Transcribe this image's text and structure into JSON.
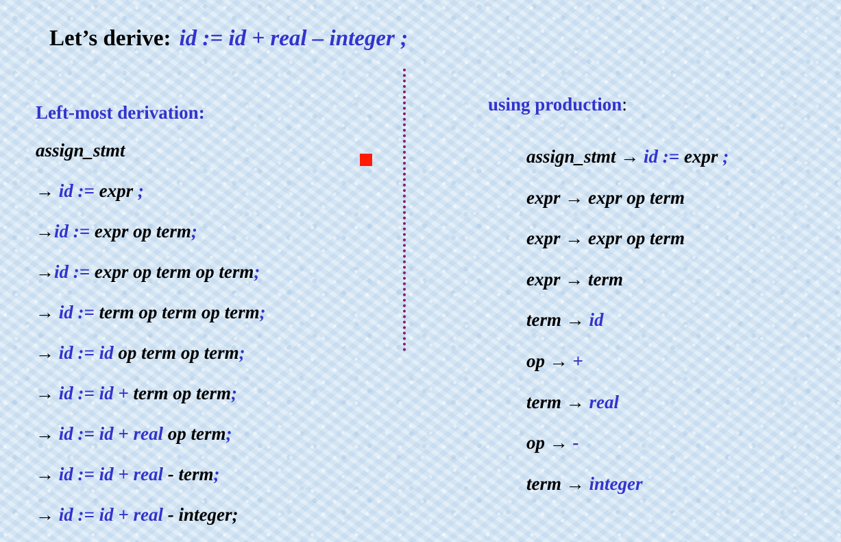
{
  "title": {
    "label": "Let’s derive:",
    "expression": "id := id + real – integer ;"
  },
  "left": {
    "heading": "Left-most derivation:",
    "rows": [
      [
        {
          "t": "assign_stmt",
          "c": "black"
        }
      ],
      [
        {
          "t": "→ ",
          "c": "black"
        },
        {
          "t": "id := ",
          "c": "blue"
        },
        {
          "t": "expr ",
          "c": "black"
        },
        {
          "t": ";",
          "c": "blue"
        }
      ],
      [
        {
          "t": "→",
          "c": "black"
        },
        {
          "t": "id := ",
          "c": "blue"
        },
        {
          "t": "expr op term",
          "c": "black"
        },
        {
          "t": ";",
          "c": "blue"
        }
      ],
      [
        {
          "t": "→",
          "c": "black"
        },
        {
          "t": "id := ",
          "c": "blue"
        },
        {
          "t": "expr op term op term",
          "c": "black"
        },
        {
          "t": ";",
          "c": "blue"
        }
      ],
      [
        {
          "t": "→ ",
          "c": "black"
        },
        {
          "t": "id := ",
          "c": "blue"
        },
        {
          "t": "term op term op term",
          "c": "black"
        },
        {
          "t": ";",
          "c": "blue"
        }
      ],
      [
        {
          "t": "→ ",
          "c": "black"
        },
        {
          "t": "id := id ",
          "c": "blue"
        },
        {
          "t": "op term op term",
          "c": "black"
        },
        {
          "t": ";",
          "c": "blue"
        }
      ],
      [
        {
          "t": "→ ",
          "c": "black"
        },
        {
          "t": "id := id + ",
          "c": "blue"
        },
        {
          "t": "term op term",
          "c": "black"
        },
        {
          "t": ";",
          "c": "blue"
        }
      ],
      [
        {
          "t": "→ ",
          "c": "black"
        },
        {
          "t": "id := id + real ",
          "c": "blue"
        },
        {
          "t": "op term",
          "c": "black"
        },
        {
          "t": ";",
          "c": "blue"
        }
      ],
      [
        {
          "t": "→ ",
          "c": "black"
        },
        {
          "t": "id := id + real ",
          "c": "blue"
        },
        {
          "t": "- term",
          "c": "black"
        },
        {
          "t": ";",
          "c": "blue"
        }
      ],
      [
        {
          "t": "→ ",
          "c": "black"
        },
        {
          "t": "id := id + real ",
          "c": "blue"
        },
        {
          "t": "- integer;",
          "c": "black"
        }
      ]
    ]
  },
  "right": {
    "heading": "using production",
    "heading_colon": ":",
    "rows": [
      [
        {
          "t": "assign_stmt → ",
          "c": "black"
        },
        {
          "t": "id := ",
          "c": "blue"
        },
        {
          "t": "expr ",
          "c": "black"
        },
        {
          "t": ";",
          "c": "blue"
        }
      ],
      [
        {
          "t": "expr → expr op term",
          "c": "black"
        }
      ],
      [
        {
          "t": "expr → expr op term",
          "c": "black"
        }
      ],
      [
        {
          "t": "expr → term",
          "c": "black"
        }
      ],
      [
        {
          "t": "term → ",
          "c": "black"
        },
        {
          "t": "id",
          "c": "blue"
        }
      ],
      [
        {
          "t": "op → ",
          "c": "black"
        },
        {
          "t": "+",
          "c": "blue"
        }
      ],
      [
        {
          "t": "term → ",
          "c": "black"
        },
        {
          "t": "real",
          "c": "blue"
        }
      ],
      [
        {
          "t": "op → ",
          "c": "black"
        },
        {
          "t": "-",
          "c": "blue"
        }
      ],
      [
        {
          "t": "term → ",
          "c": "black"
        },
        {
          "t": "integer",
          "c": "blue"
        }
      ]
    ]
  },
  "colors": {
    "blue": "#3333cc",
    "black": "#000000",
    "divider": "#8a1a6a",
    "marker": "#ff1a00",
    "background": "#d6e7f5"
  }
}
